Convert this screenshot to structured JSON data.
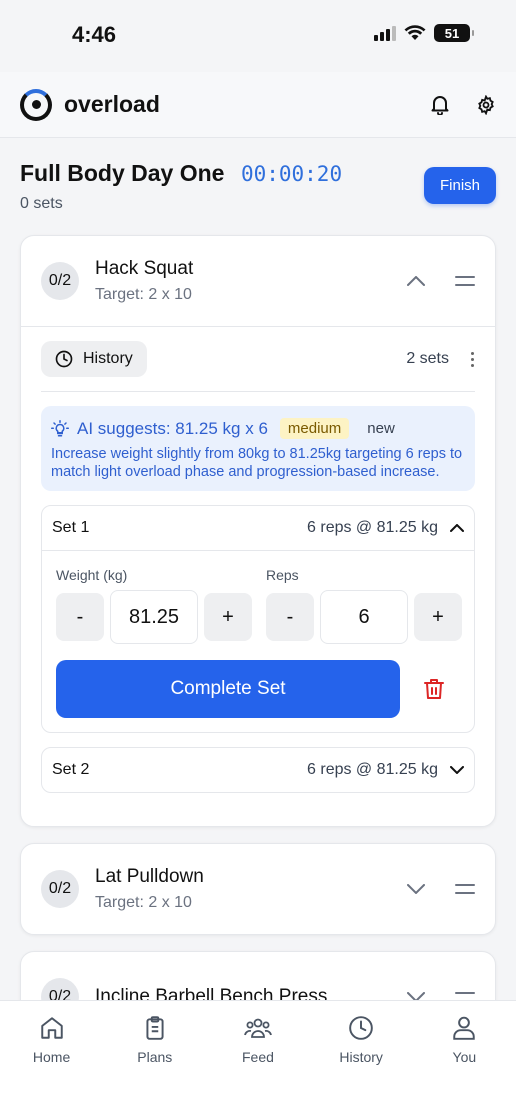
{
  "status": {
    "time": "4:46",
    "battery": "51"
  },
  "header": {
    "brand": "overload"
  },
  "workout": {
    "title": "Full Body Day One",
    "timer": "00:00:20",
    "sets_count": "0 sets",
    "finish_label": "Finish"
  },
  "exercises": [
    {
      "progress": "0/2",
      "name": "Hack Squat",
      "target": "Target: 2 x 10",
      "history_label": "History",
      "sets_label": "2 sets",
      "ai": {
        "title": "AI suggests: 81.25 kg x 6",
        "confidence": "medium",
        "status": "new",
        "description": "Increase weight slightly from 80kg to 81.25kg targeting 6 reps to match light overload phase and progression-based increase."
      },
      "sets": [
        {
          "name": "Set 1",
          "summary": "6 reps @ 81.25 kg",
          "weight_label": "Weight (kg)",
          "reps_label": "Reps",
          "weight": "81.25",
          "reps": "6",
          "complete_label": "Complete Set"
        },
        {
          "name": "Set 2",
          "summary": "6 reps @ 81.25 kg"
        }
      ]
    },
    {
      "progress": "0/2",
      "name": "Lat Pulldown",
      "target": "Target: 2 x 10"
    },
    {
      "progress": "0/2",
      "name": "Incline Barbell Bench Press"
    }
  ],
  "stepper": {
    "minus": "-",
    "plus": "+"
  },
  "nav": [
    {
      "label": "Home",
      "icon": "home-icon"
    },
    {
      "label": "Plans",
      "icon": "clipboard-icon"
    },
    {
      "label": "Feed",
      "icon": "people-icon"
    },
    {
      "label": "History",
      "icon": "clock-icon"
    },
    {
      "label": "You",
      "icon": "user-icon"
    }
  ],
  "colors": {
    "primary": "#2563eb",
    "timer": "#2f6fdc",
    "ai_bg": "#eaf1fd",
    "danger": "#dc2626"
  }
}
